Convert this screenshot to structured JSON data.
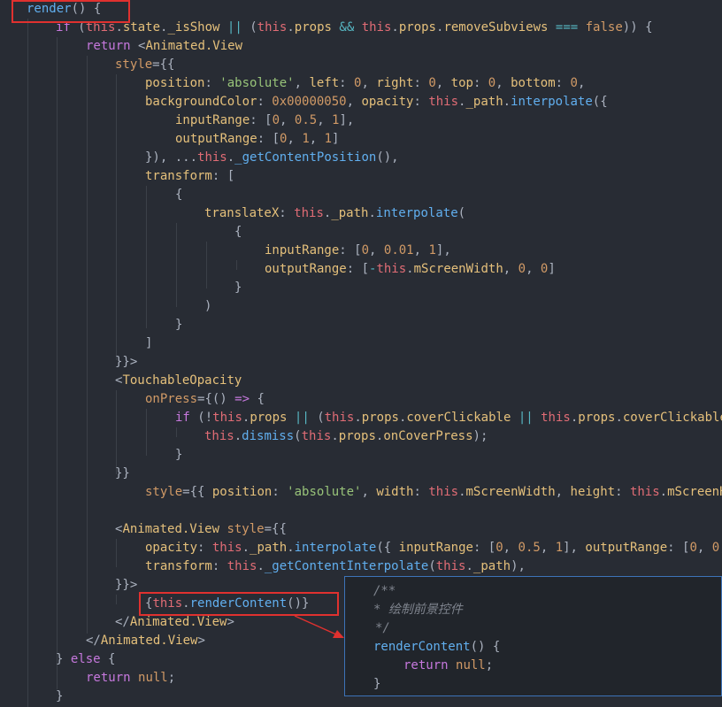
{
  "code_lines": [
    [
      [
        "fn",
        "render"
      ],
      [
        "p",
        "() {"
      ]
    ],
    [
      [
        "kw",
        "if"
      ],
      [
        "p",
        " ("
      ],
      [
        "this",
        "this"
      ],
      [
        "p",
        "."
      ],
      [
        "prop",
        "state"
      ],
      [
        "p",
        "."
      ],
      [
        "prop",
        "_isShow"
      ],
      [
        "p",
        " "
      ],
      [
        "op",
        "||"
      ],
      [
        "p",
        " ("
      ],
      [
        "this",
        "this"
      ],
      [
        "p",
        "."
      ],
      [
        "prop",
        "props"
      ],
      [
        "p",
        " "
      ],
      [
        "op",
        "&&"
      ],
      [
        "p",
        " "
      ],
      [
        "this",
        "this"
      ],
      [
        "p",
        "."
      ],
      [
        "prop",
        "props"
      ],
      [
        "p",
        "."
      ],
      [
        "prop",
        "removeSubviews"
      ],
      [
        "p",
        " "
      ],
      [
        "op",
        "==="
      ],
      [
        "p",
        " "
      ],
      [
        "num",
        "false"
      ],
      [
        "p",
        ")) {"
      ]
    ],
    [
      [
        "kw",
        "return"
      ],
      [
        "p",
        " <"
      ],
      [
        "tag",
        "Animated.View"
      ]
    ],
    [
      [
        "attr",
        "style"
      ],
      [
        "p",
        "={{"
      ]
    ],
    [
      [
        "prop",
        "position"
      ],
      [
        "p",
        ": "
      ],
      [
        "str",
        "'absolute'"
      ],
      [
        "p",
        ", "
      ],
      [
        "prop",
        "left"
      ],
      [
        "p",
        ": "
      ],
      [
        "num",
        "0"
      ],
      [
        "p",
        ", "
      ],
      [
        "prop",
        "right"
      ],
      [
        "p",
        ": "
      ],
      [
        "num",
        "0"
      ],
      [
        "p",
        ", "
      ],
      [
        "prop",
        "top"
      ],
      [
        "p",
        ": "
      ],
      [
        "num",
        "0"
      ],
      [
        "p",
        ", "
      ],
      [
        "prop",
        "bottom"
      ],
      [
        "p",
        ": "
      ],
      [
        "num",
        "0"
      ],
      [
        "p",
        ","
      ]
    ],
    [
      [
        "prop",
        "backgroundColor"
      ],
      [
        "p",
        ": "
      ],
      [
        "num",
        "0x00000050"
      ],
      [
        "p",
        ", "
      ],
      [
        "prop",
        "opacity"
      ],
      [
        "p",
        ": "
      ],
      [
        "this",
        "this"
      ],
      [
        "p",
        "."
      ],
      [
        "prop",
        "_path"
      ],
      [
        "p",
        "."
      ],
      [
        "fn",
        "interpolate"
      ],
      [
        "p",
        "({"
      ]
    ],
    [
      [
        "prop",
        "inputRange"
      ],
      [
        "p",
        ": ["
      ],
      [
        "num",
        "0"
      ],
      [
        "p",
        ", "
      ],
      [
        "num",
        "0.5"
      ],
      [
        "p",
        ", "
      ],
      [
        "num",
        "1"
      ],
      [
        "p",
        "],"
      ]
    ],
    [
      [
        "prop",
        "outputRange"
      ],
      [
        "p",
        ": ["
      ],
      [
        "num",
        "0"
      ],
      [
        "p",
        ", "
      ],
      [
        "num",
        "1"
      ],
      [
        "p",
        ", "
      ],
      [
        "num",
        "1"
      ],
      [
        "p",
        "]"
      ]
    ],
    [
      [
        "p",
        "}), ..."
      ],
      [
        "this",
        "this"
      ],
      [
        "p",
        "."
      ],
      [
        "fn",
        "_getContentPosition"
      ],
      [
        "p",
        "(),"
      ]
    ],
    [
      [
        "prop",
        "transform"
      ],
      [
        "p",
        ": ["
      ]
    ],
    [
      [
        "p",
        "{"
      ]
    ],
    [
      [
        "prop",
        "translateX"
      ],
      [
        "p",
        ": "
      ],
      [
        "this",
        "this"
      ],
      [
        "p",
        "."
      ],
      [
        "prop",
        "_path"
      ],
      [
        "p",
        "."
      ],
      [
        "fn",
        "interpolate"
      ],
      [
        "p",
        "("
      ]
    ],
    [
      [
        "p",
        "{"
      ]
    ],
    [
      [
        "prop",
        "inputRange"
      ],
      [
        "p",
        ": ["
      ],
      [
        "num",
        "0"
      ],
      [
        "p",
        ", "
      ],
      [
        "num",
        "0.01"
      ],
      [
        "p",
        ", "
      ],
      [
        "num",
        "1"
      ],
      [
        "p",
        "],"
      ]
    ],
    [
      [
        "prop",
        "outputRange"
      ],
      [
        "p",
        ": ["
      ],
      [
        "op",
        "-"
      ],
      [
        "this",
        "this"
      ],
      [
        "p",
        "."
      ],
      [
        "prop",
        "mScreenWidth"
      ],
      [
        "p",
        ", "
      ],
      [
        "num",
        "0"
      ],
      [
        "p",
        ", "
      ],
      [
        "num",
        "0"
      ],
      [
        "p",
        "]"
      ]
    ],
    [
      [
        "p",
        "}"
      ]
    ],
    [
      [
        "p",
        ")"
      ]
    ],
    [
      [
        "p",
        "}"
      ]
    ],
    [
      [
        "p",
        "]"
      ]
    ],
    [
      [
        "p",
        "}}>"
      ]
    ],
    [
      [
        "p",
        "<"
      ],
      [
        "tag",
        "TouchableOpacity"
      ]
    ],
    [
      [
        "attr",
        "onPress"
      ],
      [
        "p",
        "={() "
      ],
      [
        "kw",
        "=>"
      ],
      [
        "p",
        " {"
      ]
    ],
    [
      [
        "kw",
        "if"
      ],
      [
        "p",
        " (!"
      ],
      [
        "this",
        "this"
      ],
      [
        "p",
        "."
      ],
      [
        "prop",
        "props"
      ],
      [
        "p",
        " "
      ],
      [
        "op",
        "||"
      ],
      [
        "p",
        " ("
      ],
      [
        "this",
        "this"
      ],
      [
        "p",
        "."
      ],
      [
        "prop",
        "props"
      ],
      [
        "p",
        "."
      ],
      [
        "prop",
        "coverClickable"
      ],
      [
        "p",
        " "
      ],
      [
        "op",
        "||"
      ],
      [
        "p",
        " "
      ],
      [
        "this",
        "this"
      ],
      [
        "p",
        "."
      ],
      [
        "prop",
        "props"
      ],
      [
        "p",
        "."
      ],
      [
        "prop",
        "coverClickable"
      ]
    ],
    [
      [
        "this",
        "this"
      ],
      [
        "p",
        "."
      ],
      [
        "fn",
        "dismiss"
      ],
      [
        "p",
        "("
      ],
      [
        "this",
        "this"
      ],
      [
        "p",
        "."
      ],
      [
        "prop",
        "props"
      ],
      [
        "p",
        "."
      ],
      [
        "prop",
        "onCoverPress"
      ],
      [
        "p",
        ");"
      ]
    ],
    [
      [
        "p",
        "}"
      ]
    ],
    [
      [
        "p",
        "}}"
      ]
    ],
    [
      [
        "attr",
        "style"
      ],
      [
        "p",
        "={{ "
      ],
      [
        "prop",
        "position"
      ],
      [
        "p",
        ": "
      ],
      [
        "str",
        "'absolute'"
      ],
      [
        "p",
        ", "
      ],
      [
        "prop",
        "width"
      ],
      [
        "p",
        ": "
      ],
      [
        "this",
        "this"
      ],
      [
        "p",
        "."
      ],
      [
        "prop",
        "mScreenWidth"
      ],
      [
        "p",
        ", "
      ],
      [
        "prop",
        "height"
      ],
      [
        "p",
        ": "
      ],
      [
        "this",
        "this"
      ],
      [
        "p",
        "."
      ],
      [
        "prop",
        "mScreenH"
      ]
    ],
    [],
    [
      [
        "p",
        "<"
      ],
      [
        "tag",
        "Animated.View"
      ],
      [
        "p",
        " "
      ],
      [
        "attr",
        "style"
      ],
      [
        "p",
        "={{"
      ]
    ],
    [
      [
        "prop",
        "opacity"
      ],
      [
        "p",
        ": "
      ],
      [
        "this",
        "this"
      ],
      [
        "p",
        "."
      ],
      [
        "prop",
        "_path"
      ],
      [
        "p",
        "."
      ],
      [
        "fn",
        "interpolate"
      ],
      [
        "p",
        "({ "
      ],
      [
        "prop",
        "inputRange"
      ],
      [
        "p",
        ": ["
      ],
      [
        "num",
        "0"
      ],
      [
        "p",
        ", "
      ],
      [
        "num",
        "0.5"
      ],
      [
        "p",
        ", "
      ],
      [
        "num",
        "1"
      ],
      [
        "p",
        "], "
      ],
      [
        "prop",
        "outputRange"
      ],
      [
        "p",
        ": ["
      ],
      [
        "num",
        "0"
      ],
      [
        "p",
        ", "
      ],
      [
        "num",
        "0"
      ],
      [
        "p",
        ","
      ]
    ],
    [
      [
        "prop",
        "transform"
      ],
      [
        "p",
        ": "
      ],
      [
        "this",
        "this"
      ],
      [
        "p",
        "."
      ],
      [
        "fn",
        "_getContentInterpolate"
      ],
      [
        "p",
        "("
      ],
      [
        "this",
        "this"
      ],
      [
        "p",
        "."
      ],
      [
        "prop",
        "_path"
      ],
      [
        "p",
        "),"
      ]
    ],
    [
      [
        "p",
        "}}>"
      ]
    ],
    [
      [
        "p",
        "{"
      ],
      [
        "this",
        "this"
      ],
      [
        "p",
        "."
      ],
      [
        "fn",
        "renderContent"
      ],
      [
        "p",
        "()}"
      ]
    ],
    [
      [
        "p",
        "</"
      ],
      [
        "tag",
        "Animated.View"
      ],
      [
        "p",
        ">"
      ]
    ],
    [
      [
        "p",
        "</"
      ],
      [
        "tag",
        "Animated.View"
      ],
      [
        "p",
        ">"
      ]
    ],
    [
      [
        "p",
        "} "
      ],
      [
        "kw",
        "else"
      ],
      [
        "p",
        " {"
      ]
    ],
    [
      [
        "kw",
        "return"
      ],
      [
        "p",
        " "
      ],
      [
        "num",
        "null"
      ],
      [
        "p",
        ";"
      ]
    ],
    [
      [
        "p",
        "}"
      ]
    ]
  ],
  "popup_lines": [
    [
      [
        "cm",
        "/**"
      ]
    ],
    [
      [
        "cm",
        "* 绘制前景控件"
      ]
    ],
    [
      [
        "cm",
        "*/"
      ]
    ],
    [
      [
        "fn",
        "renderContent"
      ],
      [
        "p",
        "() {"
      ]
    ],
    [
      [
        "kw",
        "return"
      ],
      [
        "p",
        " "
      ],
      [
        "num",
        "null"
      ],
      [
        "p",
        ";"
      ]
    ],
    [
      [
        "p",
        "}"
      ]
    ]
  ],
  "colors": {
    "background": "#282c34",
    "popup_background": "#21252b",
    "popup_border": "#3d73b8",
    "highlight_box": "#e0312f"
  }
}
